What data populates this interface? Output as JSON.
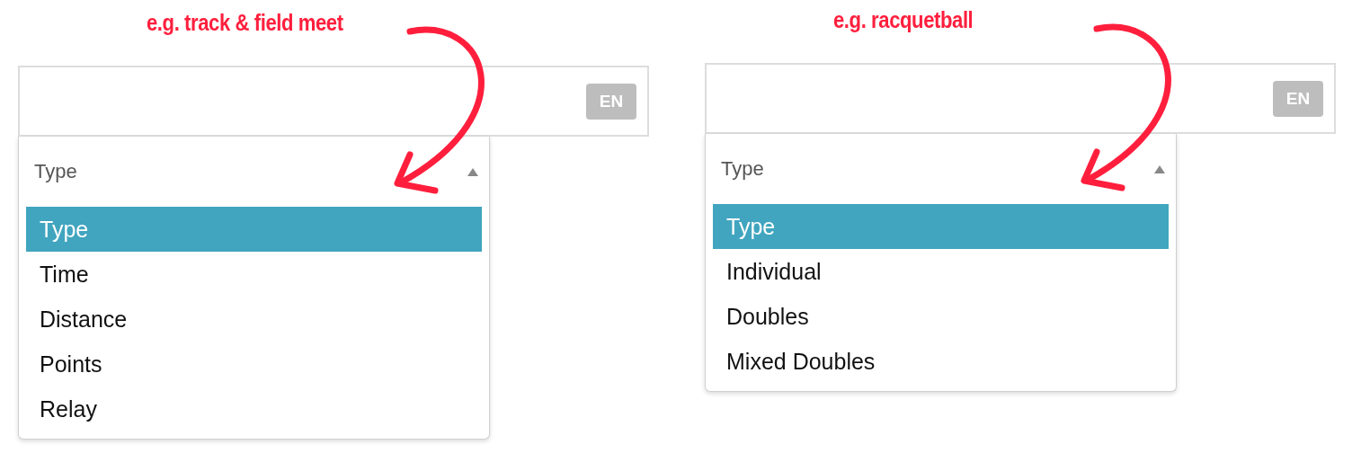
{
  "panels": [
    {
      "annotation": "e.g. track & field meet",
      "language_badge": "EN",
      "dropdown": {
        "header": "Type",
        "expanded": true,
        "options": [
          {
            "label": "Type",
            "selected": true
          },
          {
            "label": "Time",
            "selected": false
          },
          {
            "label": "Distance",
            "selected": false
          },
          {
            "label": "Points",
            "selected": false
          },
          {
            "label": "Relay",
            "selected": false
          }
        ]
      }
    },
    {
      "annotation": "e.g. racquetball",
      "language_badge": "EN",
      "dropdown": {
        "header": "Type",
        "expanded": true,
        "options": [
          {
            "label": "Type",
            "selected": true
          },
          {
            "label": "Individual",
            "selected": false
          },
          {
            "label": "Doubles",
            "selected": false
          },
          {
            "label": "Mixed Doubles",
            "selected": false
          }
        ]
      }
    }
  ]
}
